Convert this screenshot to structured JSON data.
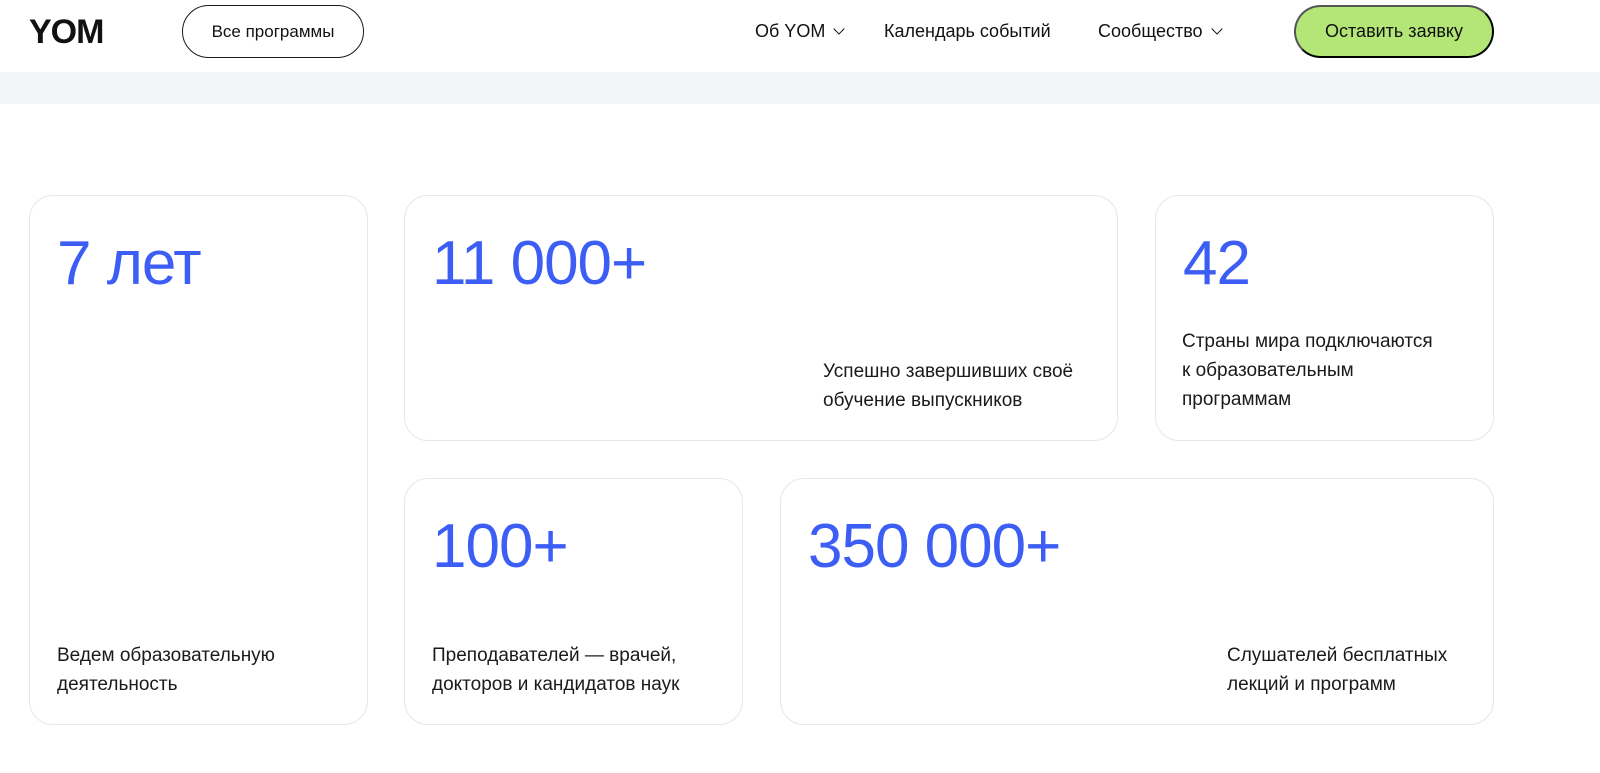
{
  "header": {
    "logo": "YOM",
    "all_programs": "Все программы",
    "nav": {
      "about": "Об YOM",
      "calendar": "Календарь событий",
      "community": "Сообщество"
    },
    "cta": "Оставить заявку"
  },
  "colors": {
    "accent_blue": "#3d5ef5",
    "cta_green": "#b3e577",
    "band_gray": "#f4f5f9"
  },
  "stats": {
    "years": {
      "value": "7 лет",
      "line1": "Ведем образовательную",
      "line2": "деятельность"
    },
    "graduates": {
      "value": "11 000+",
      "line1": "Успешно завершивших своё",
      "line2": "обучение выпускников"
    },
    "countries": {
      "value": "42",
      "line1": "Страны мира подключаются",
      "line2": "к образовательным",
      "line3": "программам"
    },
    "teachers": {
      "value": "100+",
      "line1": "Преподавателей — врачей,",
      "line2": "докторов и кандидатов наук"
    },
    "listeners": {
      "value": "350 000+",
      "line1": "Слушателей бесплатных",
      "line2": "лекций и программ"
    }
  }
}
